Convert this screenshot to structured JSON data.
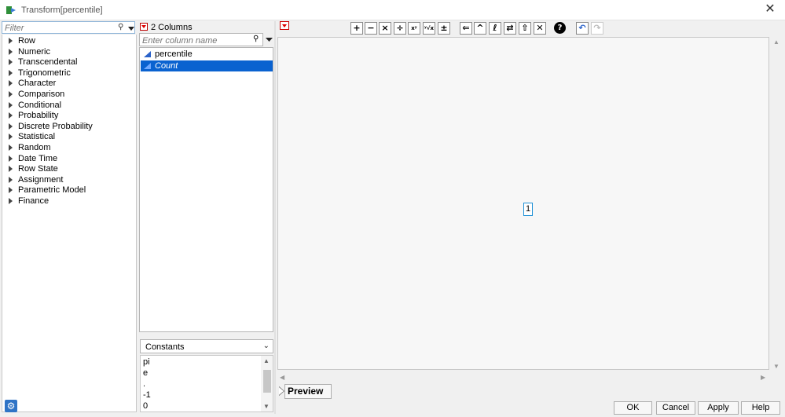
{
  "window": {
    "title": "Transform[percentile]"
  },
  "filter": {
    "placeholder": "Filter"
  },
  "categories": [
    "Row",
    "Numeric",
    "Transcendental",
    "Trigonometric",
    "Character",
    "Comparison",
    "Conditional",
    "Probability",
    "Discrete Probability",
    "Statistical",
    "Random",
    "Date Time",
    "Row State",
    "Assignment",
    "Parametric Model",
    "Finance"
  ],
  "columns": {
    "count_label": "2 Columns",
    "search_placeholder": "Enter column name",
    "items": [
      "percentile",
      "Count"
    ],
    "selected": "Count"
  },
  "constants": {
    "selected": "Constants",
    "items": [
      "pi",
      "e",
      ".",
      "-1",
      "0"
    ]
  },
  "toolbar": {
    "icons": [
      "add-icon",
      "subtract-icon",
      "multiply-icon",
      "divide-icon",
      "power-icon",
      "root-icon",
      "plus-minus-icon",
      "assign-icon",
      "raise-icon",
      "local-variable-icon",
      "swap-icon",
      "peel-icon",
      "delete-icon",
      "help-icon",
      "undo-icon",
      "redo-icon"
    ]
  },
  "editor": {
    "formula_value": "1"
  },
  "preview": {
    "label": "Preview"
  },
  "buttons": {
    "ok": "OK",
    "cancel": "Cancel",
    "apply": "Apply",
    "help": "Help"
  }
}
